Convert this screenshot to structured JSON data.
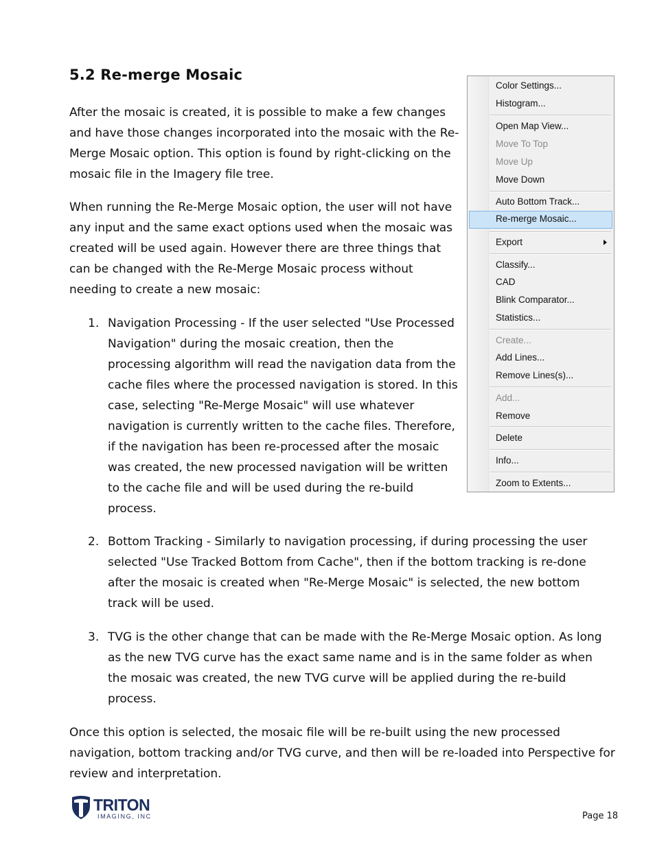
{
  "section": {
    "heading": "5.2 Re-merge Mosaic",
    "paragraphs": [
      "After the mosaic is created, it is possible to make a few changes and have those changes incorporated into the mosaic with the Re-Merge Mosaic option.  This option is found by right-clicking on the mosaic file in the Imagery file tree.",
      "When running the Re-Merge Mosaic option, the user will not have any input and the same exact options used when the mosaic was created will be used again.  However there are three things that can be changed with the Re-Merge Mosaic process without needing to create a new mosaic:"
    ],
    "list": [
      {
        "number": "1.",
        "text": "Navigation Processing - If the user selected \"Use Processed Navigation\" during the mosaic creation, then the processing algorithm will read the navigation data from the cache files where the processed navigation is stored.  In this case, selecting \"Re-Merge Mosaic\" will use whatever navigation is currently written to the cache files.  Therefore, if the navigation has been re-processed after the mosaic was created, the new processed navigation will be written to the cache file and will be used during the re-build process."
      },
      {
        "number": "2.",
        "text": "Bottom Tracking - Similarly to navigation processing, if during processing the user selected \"Use Tracked Bottom from Cache\", then if the bottom tracking is re-done after the mosaic is created when \"Re-Merge Mosaic\" is selected, the new bottom track will be used."
      },
      {
        "number": "3.",
        "text": "TVG is the other change that can be made with the Re-Merge Mosaic option.  As long as the new TVG curve has the exact same name and is in the same folder as when the mosaic was created, the new TVG curve will be applied during the re-build process."
      }
    ],
    "closing": "Once this option is selected, the mosaic file will be re-built using the new processed navigation, bottom tracking and/or TVG curve, and then will be re-loaded into Perspective for review and interpretation."
  },
  "context_menu": {
    "items": [
      {
        "label": "Color Settings...",
        "enabled": true
      },
      {
        "label": "Histogram...",
        "enabled": true
      },
      {
        "label": "Open Map View...",
        "enabled": true
      },
      {
        "label": "Move To Top",
        "enabled": false
      },
      {
        "label": "Move Up",
        "enabled": false
      },
      {
        "label": "Move Down",
        "enabled": true
      },
      {
        "label": "Auto Bottom Track...",
        "enabled": true
      },
      {
        "label": "Re-merge Mosaic...",
        "enabled": true,
        "selected": true
      },
      {
        "label": "Export",
        "enabled": true,
        "submenu": true
      },
      {
        "label": "Classify...",
        "enabled": true
      },
      {
        "label": "CAD",
        "enabled": true
      },
      {
        "label": "Blink Comparator...",
        "enabled": true
      },
      {
        "label": "Statistics...",
        "enabled": true
      },
      {
        "label": "Create...",
        "enabled": false
      },
      {
        "label": "Add Lines...",
        "enabled": true
      },
      {
        "label": "Remove Lines(s)...",
        "enabled": true
      },
      {
        "label": "Add...",
        "enabled": false
      },
      {
        "label": "Remove",
        "enabled": true
      },
      {
        "label": "Delete",
        "enabled": true
      },
      {
        "label": "Info...",
        "enabled": true
      },
      {
        "label": "Zoom to Extents...",
        "enabled": true
      }
    ],
    "highlight_color": "#cce4f7",
    "highlight_border": "#7fb4e8",
    "disabled_color": "#8a8a8a"
  },
  "footer": {
    "logo_brand": "TRITON",
    "logo_sub": "IMAGING, INC",
    "logo_icon": "triton-shield-icon",
    "logo_color": "#1c2f5e",
    "page_label": "Page 18"
  }
}
